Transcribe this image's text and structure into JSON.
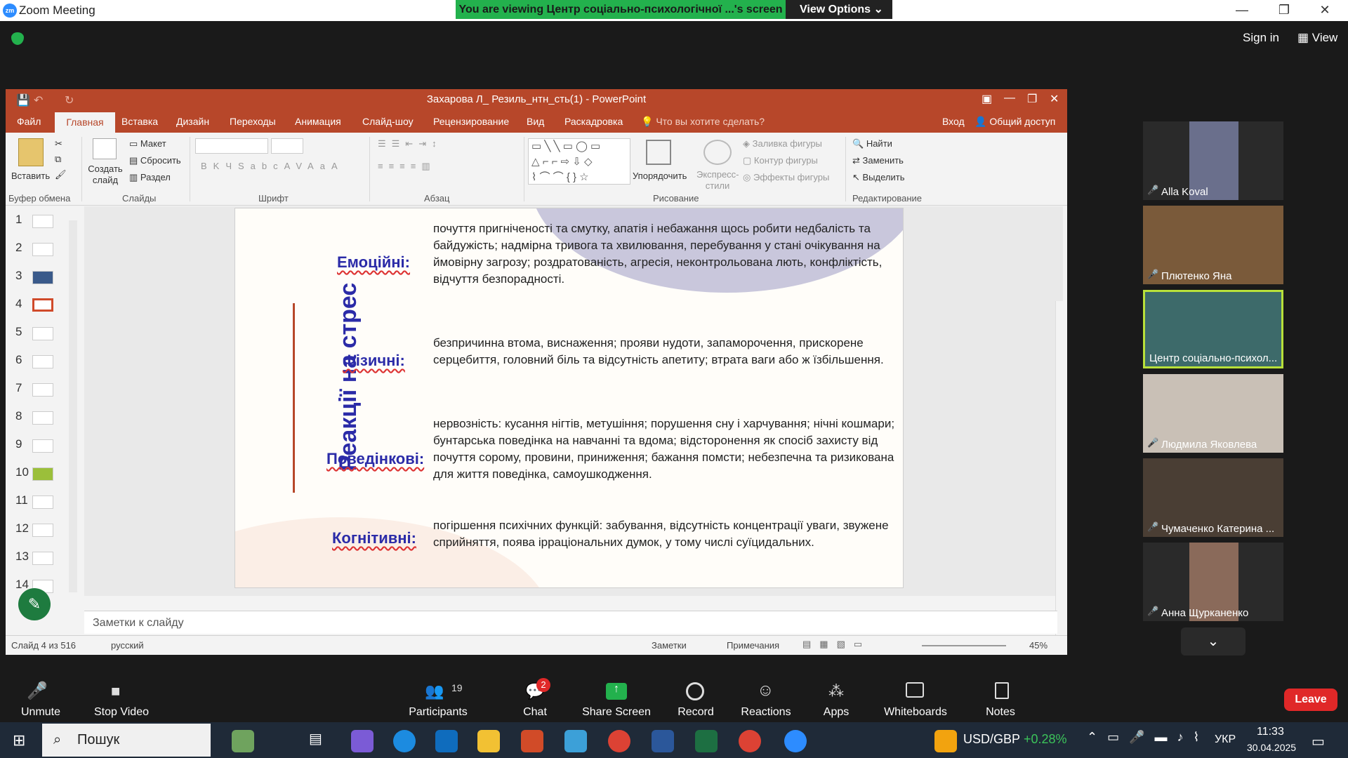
{
  "zoom": {
    "window_title": "Zoom Meeting",
    "banner": "You are viewing Центр соціально-психологічної ...'s screen",
    "view_options": "View Options",
    "sign_in": "Sign in",
    "view": "View"
  },
  "ppt": {
    "title": "Захарова Л_ Резиль_нтн_сть(1) - PowerPoint",
    "tabs": [
      "Файл",
      "Главная",
      "Вставка",
      "Дизайн",
      "Переходы",
      "Анимация",
      "Слайд-шоу",
      "Рецензирование",
      "Вид",
      "Раскадровка"
    ],
    "tell_me": "Что вы хотите сделать?",
    "login": "Вход",
    "share": "Общий доступ",
    "ribbon": {
      "paste": "Вставить",
      "new_slide": "Создать слайд",
      "layout": "Макет",
      "reset": "Сбросить",
      "section": "Раздел",
      "arrange": "Упорядочить",
      "quick_styles": "Экспресс-стили",
      "fill": "Заливка фигуры",
      "outline": "Контур фигуры",
      "effects": "Эффекты фигуры",
      "find": "Найти",
      "replace": "Заменить",
      "select": "Выделить",
      "groups": [
        "Буфер обмена",
        "Слайды",
        "Шрифт",
        "Абзац",
        "Рисование",
        "Редактирование"
      ]
    },
    "slide_numbers": [
      "1",
      "2",
      "3",
      "4",
      "5",
      "6",
      "7",
      "8",
      "9",
      "10",
      "11",
      "12",
      "13",
      "14"
    ],
    "slide": {
      "title": "Реакції на стрес",
      "rows": [
        {
          "label": "Емоційні:",
          "text": "почуття пригніченості та смутку, апатія і небажання щось робити недбалість та байдужість; надмірна тривога та хвилювання, перебування у стані очікування на ймовірну загрозу; роздратованість, агресія, неконтрольована лють, конфліктість, відчуття безпорадності."
        },
        {
          "label": "Фізичні:",
          "text": "безпричинна втома, виснаження; прояви нудоти, запаморочення, прискорене серцебиття, головний біль та відсутність апетиту; втрата ваги або ж їзбільшення."
        },
        {
          "label": "Поведінкові:",
          "text": "нервозність: кусання нігтів, метушіння; порушення сну і харчування; нічні кошмари; бунтарська поведінка на навчанні та вдома; відсторонення як спосіб захисту від почуття сорому, провини, приниження; бажання помсти; небезпечна та ризикована для життя поведінка, самоушкодження."
        },
        {
          "label": "Когнітивні:",
          "text": "погіршення психічних функцій: забування, відсутність концентрації уваги, звужене сприйняття, поява ірраціональних думок, у тому числі суїцидальних."
        }
      ]
    },
    "notes_placeholder": "Заметки к слайду",
    "status_slide": "Слайд 4 из 516",
    "status_lang": "русский",
    "status_notes": "Заметки",
    "status_comments": "Примечания",
    "zoom_level": "45%"
  },
  "participants": [
    {
      "name": "Alla Koval"
    },
    {
      "name": "Плютенко Яна"
    },
    {
      "name": "Центр соціально-психол..."
    },
    {
      "name": "Людмила Яковлева"
    },
    {
      "name": "Чумаченко Катерина ..."
    },
    {
      "name": "Анна Щурканенко"
    }
  ],
  "toolbar": {
    "unmute": "Unmute",
    "stop_video": "Stop Video",
    "participants": "Participants",
    "participants_count": "19",
    "chat": "Chat",
    "chat_badge": "2",
    "share_screen": "Share Screen",
    "record": "Record",
    "reactions": "Reactions",
    "apps": "Apps",
    "whiteboards": "Whiteboards",
    "notes": "Notes",
    "leave": "Leave"
  },
  "taskbar": {
    "search": "Пошук",
    "ticker": "USD/GBP",
    "ticker_change": "+0.28%",
    "lang": "УКР",
    "time": "11:33",
    "date": "30.04.2025"
  },
  "colors": {
    "ppt_accent": "#b7472a",
    "zoom_green": "#23b14d",
    "slide_title": "#2b2ba8",
    "leave": "#e02828"
  }
}
